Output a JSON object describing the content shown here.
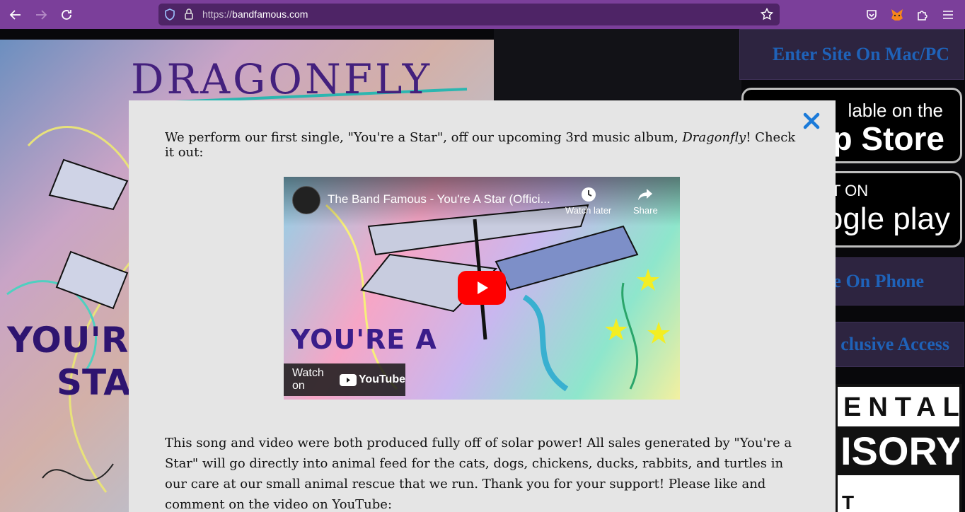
{
  "browser": {
    "url_scheme": "https://",
    "url_host": "bandfamous.com"
  },
  "background": {
    "album_title": "DRAGONFLY",
    "art_text_line1": "YOU'R",
    "art_text_line2": "STA",
    "enter_site_label": "Enter Site On Mac/PC",
    "app_store_small": "lable on the",
    "app_store_big": "op Store",
    "google_small": "T ON",
    "google_big": "ogle play",
    "phone_label": "e On Phone",
    "exclusive_label": "clusive Access",
    "advisory_line1": "ENTAL",
    "advisory_line2": "ISORY",
    "advisory_line3": "T CONTENT"
  },
  "modal": {
    "intro_before": "We perform our first single, \"You're a Star\", off our upcoming 3rd music album, ",
    "intro_album": "Dragonfly",
    "intro_after": "! Check it out:",
    "video": {
      "title": "The Band Famous - You're A Star (Offici...",
      "watch_later": "Watch later",
      "share": "Share",
      "watch_on": "Watch on",
      "youtube": "YouTube",
      "caption": "YOU'RE A"
    },
    "body_text": "This song and video were both produced fully off of solar power! All sales generated by \"You're a Star\" will go directly into animal feed for the cats, dogs, chickens, ducks, rabbits, and turtles in our care at our small animal rescue that we run. Thank you for your support! Please like and comment on the video on YouTube:"
  },
  "colors": {
    "toolbar": "#7b3f9a",
    "urlbar": "#4e2466",
    "modal_bg": "#e5e5e5",
    "close_accent": "#1a7ad9",
    "youtube_red": "#ff0000",
    "link_blue": "#1f62b8"
  }
}
